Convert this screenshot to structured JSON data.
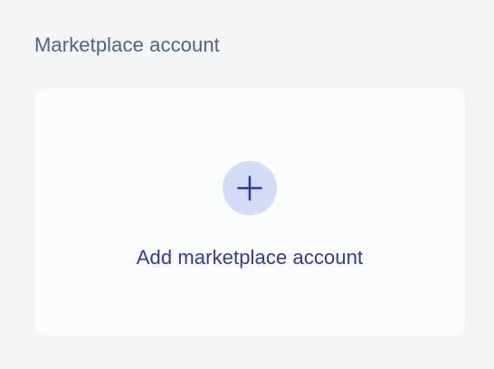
{
  "section": {
    "title": "Marketplace account"
  },
  "add_card": {
    "icon": "plus-icon",
    "label": "Add marketplace account"
  },
  "colors": {
    "background": "#f4f5f7",
    "card": "#fbfcfc",
    "title_text": "#4e6487",
    "accent_text": "#2f3b96",
    "icon_circle": "#d3dcf6"
  }
}
